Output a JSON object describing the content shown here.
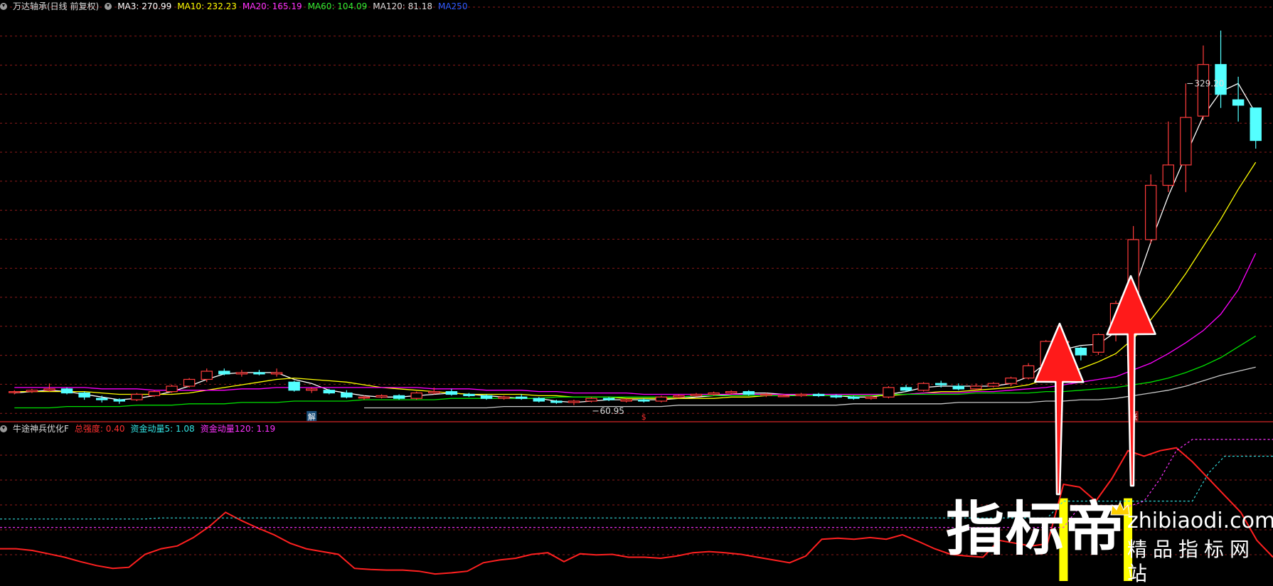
{
  "colors": {
    "background": "#000000",
    "up": "#ff3b3b",
    "down": "#54ffff",
    "grid": "#8b1a1a",
    "ma3": "#ffffff",
    "ma10": "#ffff00",
    "ma20": "#ff00ff",
    "ma60": "#00e000",
    "ma120": "#c8c8c8",
    "ma250": "#2050ff",
    "arrow": "#ff1a1a",
    "highlight": "#ffff00"
  },
  "main_header": {
    "icon": "options-circle-icon",
    "stock": "万达轴承(日线 前复权)",
    "ma3": "MA3: 270.99",
    "ma10": "MA10: 232.23",
    "ma20": "MA20: 165.19",
    "ma60": "MA60: 104.09",
    "ma120": "MA120: 81.18",
    "ma250": "MA250"
  },
  "sub_header": {
    "icon": "options-circle-icon",
    "name": "牛途神兵优化F",
    "total": "总强度: 0.40",
    "flow5": "资金动量5: 1.08",
    "flow120": "资金动量120: 1.19"
  },
  "watermark": {
    "big": "指标帝",
    "domain": "zhibiaodi.com",
    "slogan": "精品指标网站",
    "icon": "crown-icon"
  },
  "chart_data": [
    {
      "type": "candlestick",
      "title": "万达轴承(日线 前复权)",
      "ylim": [
        45,
        340
      ],
      "annotations": [
        {
          "text": "329.20",
          "index": 67
        },
        {
          "text": "60.95",
          "index": 33
        }
      ],
      "markers": [
        {
          "text": "解",
          "index": 17
        },
        {
          "text": "$",
          "index": 36
        },
        {
          "text": "涨",
          "index": 64
        }
      ],
      "candles": [
        [
          63,
          64,
          61,
          63
        ],
        [
          63,
          65,
          62,
          64
        ],
        [
          64,
          69,
          63,
          65
        ],
        [
          65,
          66,
          61,
          62
        ],
        [
          62,
          63,
          57,
          59
        ],
        [
          58,
          60,
          55,
          57
        ],
        [
          57,
          58,
          54,
          56
        ],
        [
          57,
          62,
          56,
          61
        ],
        [
          60,
          64,
          59,
          63
        ],
        [
          63,
          68,
          62,
          67
        ],
        [
          67,
          73,
          66,
          72
        ],
        [
          72,
          80,
          70,
          78
        ],
        [
          78,
          80,
          75,
          76
        ],
        [
          76,
          79,
          74,
          77
        ],
        [
          77,
          79,
          75,
          76
        ],
        [
          76,
          80,
          74,
          77
        ],
        [
          70,
          71,
          63,
          64
        ],
        [
          64,
          66,
          62,
          65
        ],
        [
          64,
          65,
          61,
          62
        ],
        [
          62,
          64,
          58,
          59
        ],
        [
          59,
          60,
          57,
          59
        ],
        [
          59,
          61,
          58,
          60
        ],
        [
          60,
          61,
          57,
          58
        ],
        [
          58,
          63,
          57,
          62
        ],
        [
          62,
          66,
          61,
          63
        ],
        [
          63,
          65,
          60,
          61
        ],
        [
          61,
          62,
          59,
          60
        ],
        [
          60,
          61,
          57,
          58
        ],
        [
          58,
          60,
          57,
          59
        ],
        [
          59,
          61,
          57,
          58
        ],
        [
          58,
          59,
          55,
          56
        ],
        [
          56,
          57,
          54,
          55
        ],
        [
          55,
          57,
          53,
          56
        ],
        [
          56,
          59,
          55,
          58
        ],
        [
          58,
          59,
          56,
          57
        ],
        [
          56,
          58,
          55,
          57
        ],
        [
          57,
          58,
          55,
          56
        ],
        [
          56,
          60,
          55,
          59
        ],
        [
          59,
          61,
          58,
          60
        ],
        [
          60,
          62,
          59,
          61
        ],
        [
          61,
          63,
          60,
          62
        ],
        [
          62,
          64,
          61,
          63
        ],
        [
          63,
          64,
          60,
          61
        ],
        [
          61,
          62,
          59,
          61
        ],
        [
          60,
          61,
          59,
          60
        ],
        [
          60,
          62,
          59,
          61
        ],
        [
          61,
          62,
          59,
          60
        ],
        [
          60,
          61,
          58,
          59
        ],
        [
          59,
          60,
          57,
          58
        ],
        [
          58,
          60,
          57,
          59
        ],
        [
          59,
          67,
          58,
          66
        ],
        [
          66,
          68,
          63,
          64
        ],
        [
          64,
          70,
          63,
          69
        ],
        [
          69,
          71,
          66,
          68
        ],
        [
          67,
          69,
          64,
          65
        ],
        [
          65,
          69,
          64,
          67
        ],
        [
          67,
          70,
          66,
          69
        ],
        [
          69,
          74,
          67,
          73
        ],
        [
          73,
          84,
          72,
          82
        ],
        [
          82,
          101,
          80,
          100
        ],
        [
          100,
          101,
          90,
          100
        ],
        [
          95,
          96,
          86,
          90
        ],
        [
          92,
          106,
          90,
          105
        ],
        [
          105,
          130,
          100,
          128
        ],
        [
          130,
          185,
          126,
          175
        ],
        [
          175,
          223,
          172,
          215
        ],
        [
          215,
          262,
          210,
          230
        ],
        [
          230,
          290,
          210,
          265
        ],
        [
          266,
          318,
          263,
          304
        ],
        [
          304,
          329,
          272,
          282
        ],
        [
          278,
          295,
          262,
          274
        ],
        [
          272,
          272,
          242,
          248
        ]
      ],
      "ma": {
        "ma3": [
          62,
          63,
          64,
          63,
          61,
          59,
          57,
          58,
          60,
          63,
          67,
          72,
          76,
          77,
          77,
          77,
          72,
          69,
          64,
          62,
          60,
          59,
          59,
          60,
          61,
          62,
          61,
          60,
          59,
          58,
          58,
          56,
          55,
          56,
          57,
          57,
          57,
          57,
          58,
          59,
          60,
          61,
          62,
          62,
          61,
          60,
          60,
          60,
          59,
          59,
          61,
          63,
          66,
          67,
          67,
          67,
          67,
          69,
          74,
          84,
          94,
          97,
          98,
          107,
          136,
          173,
          207,
          237,
          266,
          284,
          290,
          268
        ],
        "ma10": [
          63,
          63,
          63,
          63,
          63,
          62,
          61,
          61,
          61,
          61,
          62,
          64,
          66,
          68,
          70,
          72,
          73,
          72,
          71,
          70,
          68,
          66,
          65,
          64,
          63,
          62,
          61,
          61,
          61,
          61,
          60,
          60,
          59,
          59,
          59,
          58,
          58,
          58,
          58,
          58,
          58,
          59,
          59,
          60,
          60,
          60,
          60,
          60,
          60,
          60,
          60,
          61,
          62,
          63,
          63,
          64,
          65,
          66,
          68,
          72,
          76,
          80,
          85,
          91,
          102,
          116,
          132,
          150,
          170,
          190,
          212,
          232
        ],
        "ma20": [
          66,
          66,
          66,
          66,
          66,
          65,
          65,
          65,
          64,
          64,
          64,
          64,
          64,
          65,
          65,
          66,
          66,
          66,
          66,
          66,
          66,
          66,
          66,
          66,
          65,
          65,
          65,
          64,
          64,
          64,
          63,
          63,
          62,
          62,
          62,
          62,
          61,
          61,
          61,
          61,
          61,
          61,
          61,
          61,
          61,
          61,
          61,
          61,
          61,
          61,
          61,
          61,
          62,
          62,
          62,
          63,
          63,
          64,
          65,
          66,
          68,
          70,
          72,
          74,
          79,
          84,
          91,
          99,
          108,
          120,
          138,
          165
        ],
        "ma60": [
          51,
          51,
          51,
          52,
          52,
          52,
          52,
          53,
          53,
          53,
          54,
          54,
          54,
          55,
          55,
          55,
          56,
          56,
          56,
          56,
          57,
          57,
          57,
          57,
          57,
          58,
          58,
          58,
          58,
          58,
          58,
          59,
          59,
          59,
          59,
          59,
          59,
          59,
          59,
          60,
          60,
          60,
          60,
          60,
          60,
          60,
          60,
          60,
          60,
          60,
          61,
          61,
          61,
          61,
          61,
          62,
          62,
          62,
          62,
          63,
          63,
          64,
          65,
          66,
          68,
          70,
          73,
          77,
          82,
          88,
          96,
          104
        ],
        "ma120": [
          null,
          null,
          null,
          null,
          null,
          null,
          null,
          null,
          null,
          null,
          null,
          null,
          null,
          null,
          null,
          null,
          null,
          null,
          null,
          null,
          51,
          51,
          51,
          51,
          51,
          51,
          51,
          51,
          52,
          52,
          52,
          52,
          52,
          52,
          52,
          52,
          52,
          52,
          53,
          53,
          53,
          53,
          53,
          53,
          53,
          53,
          53,
          53,
          54,
          54,
          54,
          54,
          54,
          54,
          55,
          55,
          55,
          55,
          55,
          56,
          56,
          57,
          57,
          58,
          60,
          62,
          64,
          67,
          71,
          75,
          78,
          81
        ]
      }
    },
    {
      "type": "line",
      "title": "牛途神兵优化F",
      "ylim": [
        0,
        2.6
      ],
      "series": [
        {
          "name": "总强度",
          "values": [
            0.55,
            0.55,
            0.52,
            0.46,
            0.4,
            0.32,
            0.25,
            0.2,
            0.22,
            0.45,
            0.55,
            0.6,
            0.75,
            0.95,
            1.2,
            1.05,
            0.92,
            0.8,
            0.65,
            0.55,
            0.5,
            0.45,
            0.2,
            0.18,
            0.17,
            0.17,
            0.15,
            0.1,
            0.12,
            0.15,
            0.3,
            0.35,
            0.38,
            0.45,
            0.48,
            0.32,
            0.46,
            0.44,
            0.45,
            0.4,
            0.4,
            0.38,
            0.42,
            0.48,
            0.5,
            0.48,
            0.45,
            0.4,
            0.35,
            0.3,
            0.42,
            0.72,
            0.74,
            0.72,
            0.75,
            0.72,
            0.8,
            0.68,
            0.55,
            0.45,
            0.42,
            0.4,
            0.7,
            0.65,
            0.6,
            0.64,
            1.7,
            1.65,
            1.4,
            1.8,
            2.3,
            2.2,
            2.3,
            2.35,
            2.1,
            1.8,
            1.5,
            1.2,
            0.7,
            0.4
          ]
        },
        {
          "name": "资金动量5",
          "values": [
            1.08,
            1.08,
            1.08,
            1.08,
            1.08,
            1.08,
            1.08,
            1.08,
            1.08,
            1.08,
            1.1,
            1.1,
            1.1,
            1.1,
            1.1,
            1.1,
            1.1,
            1.1,
            1.1,
            1.1,
            1.1,
            1.1,
            1.1,
            1.1,
            1.1,
            1.1,
            1.1,
            1.1,
            1.1,
            1.1,
            1.1,
            1.1,
            1.1,
            1.1,
            1.1,
            1.1,
            1.1,
            1.1,
            1.1,
            1.1,
            1.1,
            1.1,
            1.1,
            1.1,
            1.1,
            1.1,
            1.1,
            1.1,
            1.1,
            1.1,
            1.1,
            1.1,
            1.1,
            1.1,
            1.1,
            1.1,
            1.1,
            1.1,
            1.1,
            1.1,
            1.1,
            1.1,
            1.1,
            1.1,
            1.1,
            1.1,
            1.4,
            1.4,
            1.4,
            1.4,
            1.4,
            1.4,
            1.4,
            1.4,
            1.4,
            1.9,
            2.2,
            2.2,
            2.2,
            2.2
          ]
        },
        {
          "name": "资金动量120",
          "values": [
            0.93,
            0.93,
            0.93,
            0.93,
            0.93,
            0.93,
            0.93,
            0.93,
            0.93,
            0.93,
            0.93,
            0.93,
            0.93,
            0.93,
            0.93,
            0.93,
            0.93,
            0.93,
            0.93,
            0.93,
            0.93,
            0.93,
            0.93,
            0.93,
            0.93,
            0.93,
            0.93,
            0.93,
            0.93,
            0.93,
            0.93,
            0.93,
            0.93,
            0.93,
            0.93,
            0.93,
            0.93,
            0.93,
            0.93,
            0.93,
            0.93,
            0.93,
            0.93,
            0.93,
            0.93,
            0.93,
            0.93,
            0.93,
            0.93,
            0.93,
            0.93,
            0.93,
            0.93,
            0.93,
            0.93,
            0.93,
            0.93,
            0.93,
            0.93,
            0.93,
            0.93,
            0.93,
            0.93,
            0.93,
            0.93,
            0.93,
            0.93,
            1.3,
            1.3,
            1.3,
            1.3,
            1.4,
            1.8,
            2.3,
            2.5,
            2.5,
            2.5,
            2.5,
            2.5,
            2.5
          ]
        }
      ],
      "highlight_bars": [
        66,
        70
      ]
    }
  ]
}
